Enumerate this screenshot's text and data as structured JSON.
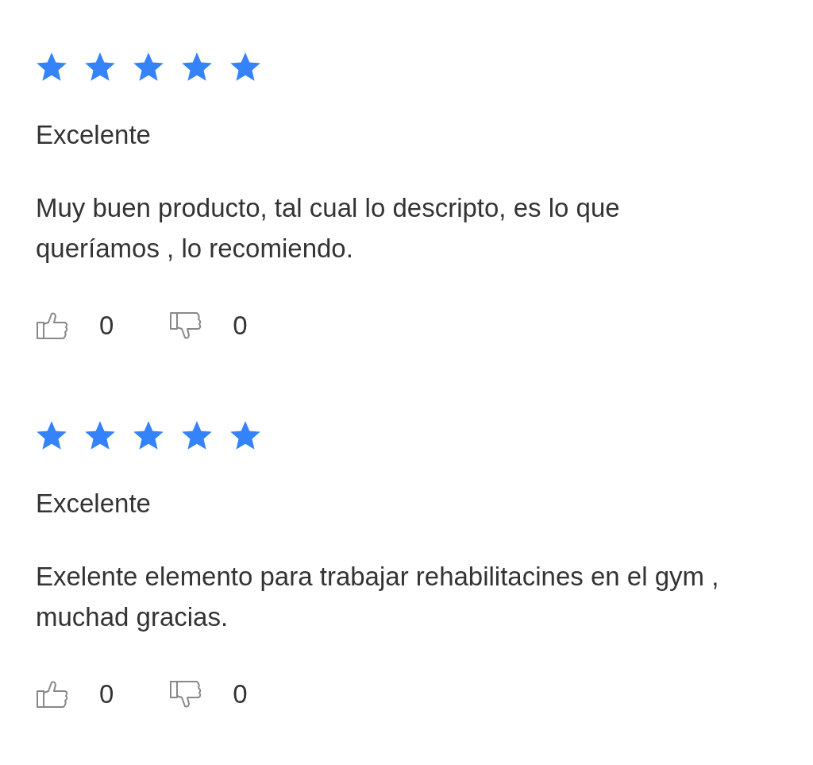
{
  "reviews": [
    {
      "stars": 5,
      "title": "Excelente",
      "body": "Muy buen producto, tal cual lo descripto, es lo que queríamos , lo recomiendo.",
      "likes": "0",
      "dislikes": "0"
    },
    {
      "stars": 5,
      "title": "Excelente",
      "body": "Exelente elemento para trabajar rehabilitacines en el gym , muchad gracias.",
      "likes": "0",
      "dislikes": "0"
    }
  ]
}
